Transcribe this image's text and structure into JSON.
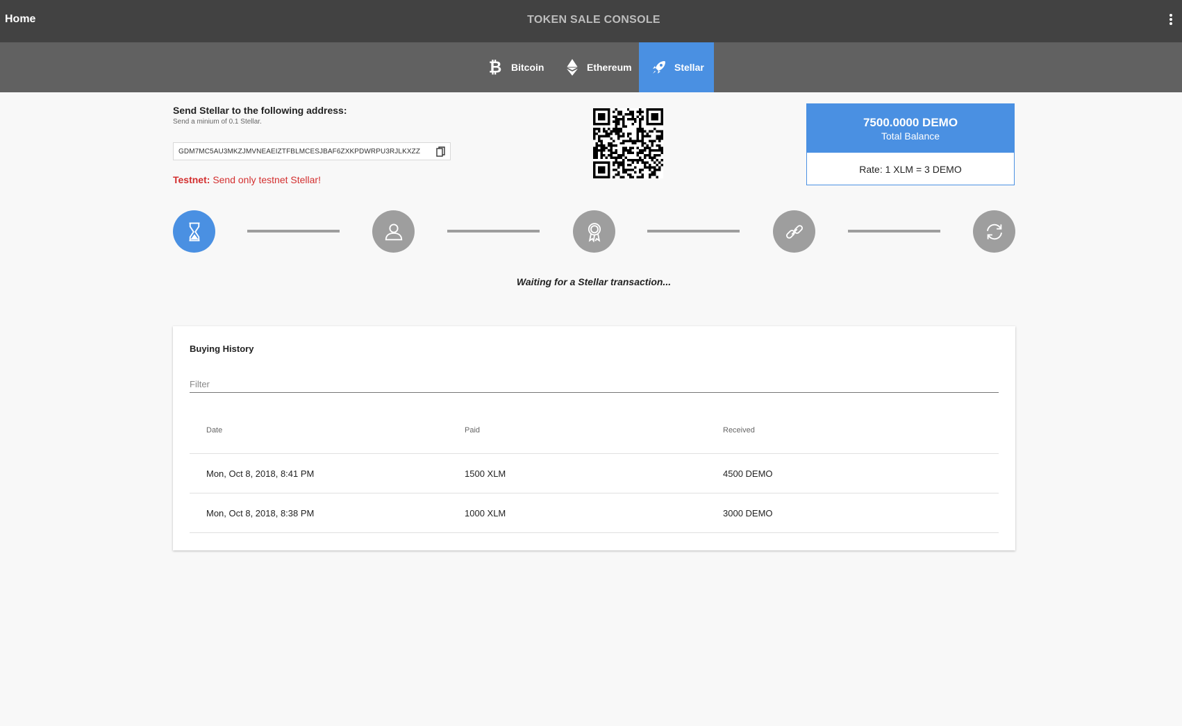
{
  "appbar": {
    "home": "Home",
    "title": "TOKEN SALE CONSOLE"
  },
  "tabs": [
    {
      "label": "Bitcoin",
      "icon": "bitcoin-icon",
      "active": false
    },
    {
      "label": "Ethereum",
      "icon": "ethereum-icon",
      "active": false
    },
    {
      "label": "Stellar",
      "icon": "rocket-icon",
      "active": true
    }
  ],
  "send": {
    "title": "Send Stellar to the following address:",
    "subtitle": "Send a minium of 0.1 Stellar.",
    "address": "GDM7MC5AU3MKZJMVNEAEIZTFBLMCESJBAF6ZXKPDWRPU3RJLKXZZ",
    "testnet_label": "Testnet:",
    "testnet_message": "Send only testnet Stellar!"
  },
  "balance": {
    "amount": "7500.0000 DEMO",
    "label": "Total Balance",
    "rate": "Rate: 1 XLM = 3 DEMO"
  },
  "steps": [
    {
      "icon": "hourglass-icon",
      "active": true
    },
    {
      "icon": "user-icon",
      "active": false
    },
    {
      "icon": "award-icon",
      "active": false
    },
    {
      "icon": "link-icon",
      "active": false
    },
    {
      "icon": "refresh-icon",
      "active": false
    }
  ],
  "status": "Waiting for a Stellar transaction...",
  "history": {
    "title": "Buying History",
    "filter_placeholder": "Filter",
    "columns": [
      "Date",
      "Paid",
      "Received"
    ],
    "rows": [
      {
        "date": "Mon, Oct 8, 2018, 8:41 PM",
        "paid": "1500 XLM",
        "received": "4500 DEMO"
      },
      {
        "date": "Mon, Oct 8, 2018, 8:38 PM",
        "paid": "1000 XLM",
        "received": "3000 DEMO"
      }
    ]
  },
  "colors": {
    "accent": "#4a90e2",
    "appbar": "#424242",
    "tabbar": "#616161",
    "warning": "#d32f2f",
    "step_inactive": "#9e9e9e"
  }
}
